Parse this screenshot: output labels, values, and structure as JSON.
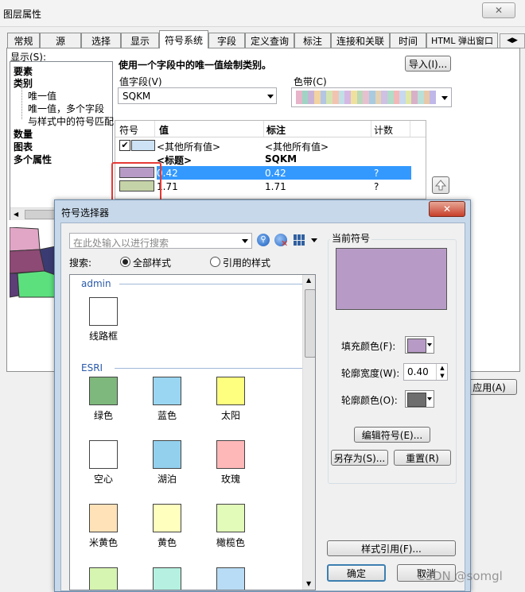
{
  "window": {
    "title": "图层属性"
  },
  "tabs": [
    "常规",
    "源",
    "选择",
    "显示",
    "符号系统",
    "字段",
    "定义查询",
    "标注",
    "连接和关联",
    "时间",
    "HTML 弹出窗口"
  ],
  "show": {
    "label": "显示(S):",
    "items": [
      "要素",
      "类别",
      "唯一值",
      "唯一值，多个字段",
      "与样式中的符号匹配",
      "数量",
      "图表",
      "多个属性"
    ]
  },
  "main": {
    "heading": "使用一个字段中的唯一值绘制类别。",
    "import_label": "导入(I)...",
    "value_field_label": "值字段(V)",
    "value_field_value": "SQKM",
    "color_ramp_label": "色带(C)",
    "ramp_colors": [
      "#e7b4c9",
      "#9fd4c4",
      "#c9b4d7",
      "#f2d3a2",
      "#b4c6e3",
      "#d4e4b0",
      "#f3c3b2",
      "#c0e0e6",
      "#d6b8e4",
      "#f0e09e",
      "#b8d8b8",
      "#e7c0d0",
      "#a8cbe0",
      "#e4d2b4",
      "#cfc0e4",
      "#b0dcc8",
      "#f2b8b8",
      "#c8d8f0",
      "#e0e8a8",
      "#d8b0c8",
      "#b8e0d8",
      "#e8c8a8",
      "#c0b8e8"
    ],
    "table": {
      "headers": [
        "符号",
        "值",
        "标注",
        "计数"
      ],
      "rows": [
        {
          "symbol_color": "#cde3f5",
          "checked": true,
          "value": "<其他所有值>",
          "label": "<其他所有值>",
          "count": ""
        },
        {
          "symbol_color": "",
          "checked": false,
          "value": "<标题>",
          "label": "SQKM",
          "count": ""
        },
        {
          "symbol_color": "#b79bc6",
          "checked": false,
          "value": "0.42",
          "label": "0.42",
          "count": "?"
        },
        {
          "symbol_color": "#c5d3a8",
          "checked": false,
          "value": "1.71",
          "label": "1.71",
          "count": "?"
        }
      ]
    },
    "apply_label": "应用(A)"
  },
  "dialog": {
    "title": "符号选择器",
    "search_placeholder": "在此处输入以进行搜索",
    "search_label": "搜索:",
    "radio_all": "全部样式",
    "radio_ref": "引用的样式",
    "groups": [
      {
        "name": "admin",
        "items": [
          {
            "label": "线路框",
            "color": "#ffffff"
          }
        ]
      },
      {
        "name": "ESRI",
        "items": [
          {
            "label": "绿色",
            "color": "#7eb87c"
          },
          {
            "label": "蓝色",
            "color": "#9ad6f2"
          },
          {
            "label": "太阳",
            "color": "#ffff7f"
          },
          {
            "label": "空心",
            "color": "#ffffff"
          },
          {
            "label": "湖泊",
            "color": "#93d0ee"
          },
          {
            "label": "玫瑰",
            "color": "#ffb8b8"
          },
          {
            "label": "米黄色",
            "color": "#ffe2b8"
          },
          {
            "label": "黄色",
            "color": "#ffffbe"
          },
          {
            "label": "橄榄色",
            "color": "#e2fbb8"
          },
          {
            "label": "",
            "color": "#d6f5b0"
          },
          {
            "label": "",
            "color": "#b5f0e0"
          },
          {
            "label": "",
            "color": "#b8dcf5"
          }
        ]
      }
    ],
    "current_symbol_label": "当前符号",
    "current_color": "#b79bc6",
    "fill_color_label": "填充颜色(F):",
    "fill_color": "#b79bc6",
    "outline_width_label": "轮廓宽度(W):",
    "outline_width": "0.40",
    "outline_color_label": "轮廓颜色(O):",
    "outline_color": "#6e6e6e",
    "edit_label": "编辑符号(E)...",
    "save_as_label": "另存为(S)...",
    "reset_label": "重置(R)",
    "style_ref_label": "样式引用(F)...",
    "ok_label": "确定",
    "cancel_label": "取消"
  },
  "watermark": "CSDN @somgl"
}
